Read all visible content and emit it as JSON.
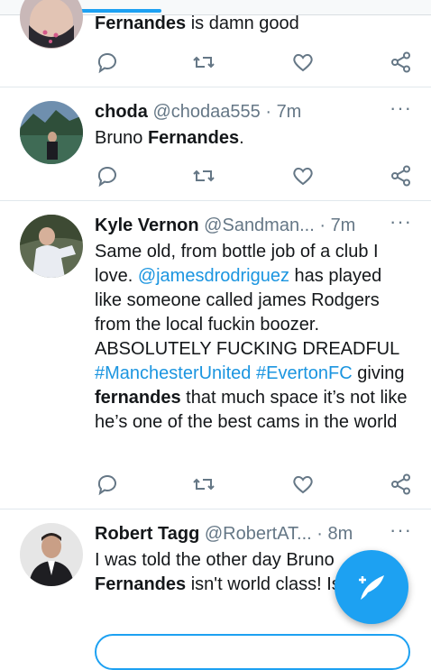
{
  "tweets": [
    {
      "name": "",
      "handle": "",
      "time": "",
      "body_part1": "Fernandes",
      "body_part2": " is damn good"
    },
    {
      "name": "choda",
      "handle": "@chodaa555",
      "dot": "·",
      "time": "7m",
      "body_part1": "Bruno ",
      "body_bold": "Fernandes",
      "body_part2": "."
    },
    {
      "name": "Kyle Vernon",
      "handle": "@Sandman...",
      "dot": "·",
      "time": "7m",
      "text_1": "Same old, from bottle job of a club I love. ",
      "mention": "@jamesdrodriguez",
      "text_2": " has played like someone called james Rodgers from the local fuckin boozer. ABSOLUTELY FUCKING DREADFUL ",
      "hashtag_1": "#ManchesterUnited",
      "space": " ",
      "hashtag_2": "#EvertonFC",
      "text_3": " giving ",
      "bold": "fernandes",
      "text_4": " that much space it’s not like he’s one of the best cams in the world"
    },
    {
      "name": "Robert Tagg",
      "handle": "@RobertAT...",
      "dot": "·",
      "time": "8m",
      "text_1": "I was told the other day Bruno ",
      "bold": "Fernandes",
      "text_2": " isn't world class! Is he?"
    }
  ],
  "more_icon": "···",
  "icons": [
    "reply-icon",
    "retweet-icon",
    "like-icon",
    "share-icon",
    "compose-tweet-icon"
  ],
  "colors": {
    "accent": "#1da1f2",
    "link": "#1b95e0",
    "muted": "#657786",
    "text": "#14171a"
  }
}
